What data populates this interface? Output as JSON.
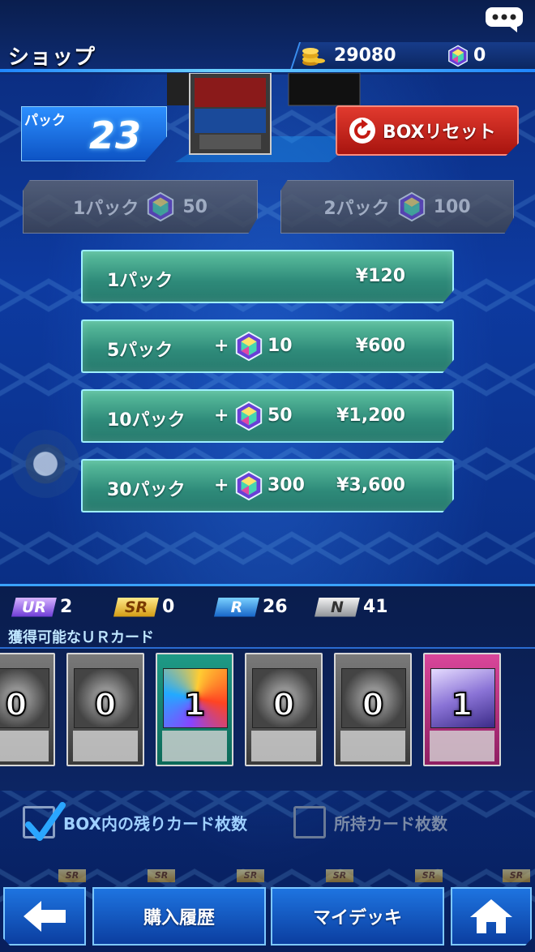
{
  "header": {
    "title": "ショップ",
    "coins": "29080",
    "gems": "0",
    "chat_icon": "chat-bubble-icon"
  },
  "pack": {
    "label": "パック",
    "count": "23",
    "reset_label": "BOXリセット"
  },
  "gem_buy": [
    {
      "qty": "1パック",
      "cost": "50"
    },
    {
      "qty": "2パック",
      "cost": "100"
    }
  ],
  "price_rows": [
    {
      "qty": "1パック",
      "plus": "",
      "bonus": "",
      "price": "¥120"
    },
    {
      "qty": "5パック",
      "plus": "+",
      "bonus": "10",
      "price": "¥600"
    },
    {
      "qty": "10パック",
      "plus": "+",
      "bonus": "50",
      "price": "¥1,200"
    },
    {
      "qty": "30パック",
      "plus": "+",
      "bonus": "300",
      "price": "¥3,600"
    }
  ],
  "rarity": {
    "ur": {
      "badge": "UR",
      "count": "2"
    },
    "sr": {
      "badge": "SR",
      "count": "0"
    },
    "r": {
      "badge": "R",
      "count": "26"
    },
    "n": {
      "badge": "N",
      "count": "41"
    }
  },
  "ur_section_label": "獲得可能なＵＲカード",
  "cards": [
    {
      "count": "0",
      "type": "monster"
    },
    {
      "count": "0",
      "type": "monster"
    },
    {
      "count": "1",
      "type": "spell"
    },
    {
      "count": "0",
      "type": "monster"
    },
    {
      "count": "0",
      "type": "monster"
    },
    {
      "count": "1",
      "type": "trap"
    }
  ],
  "checks": {
    "box_remaining": {
      "label": "BOX内の残りカード枚数",
      "checked": true
    },
    "owned": {
      "label": "所持カード枚数",
      "checked": false
    }
  },
  "sr_strip_badge": "SR",
  "nav": {
    "history": "購入履歴",
    "deck": "マイデッキ"
  },
  "colors": {
    "accent": "#3aa2ff",
    "reset": "#d42a1f",
    "price_row": "#3d9e88"
  }
}
